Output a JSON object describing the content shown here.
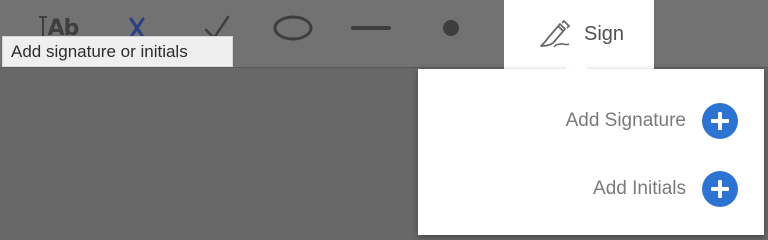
{
  "toolbar": {
    "text_tool_glyph": "Ab",
    "sign_label": "Sign",
    "icons": [
      "text-icon",
      "cross-icon",
      "checkmark-icon",
      "ellipse-icon",
      "line-icon",
      "dot-icon",
      "pen-icon"
    ]
  },
  "tooltip": {
    "text": "Add signature or initials"
  },
  "sign_menu": {
    "add_signature_label": "Add Signature",
    "add_initials_label": "Add Initials",
    "accent_color": "#2d73d2"
  }
}
